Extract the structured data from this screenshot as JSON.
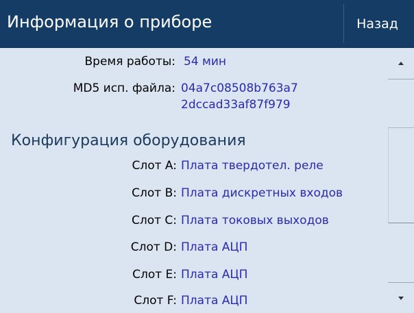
{
  "header": {
    "title": "Информация о приборе",
    "back_label": "Назад"
  },
  "device_info": {
    "uptime_label": "Время работы:",
    "uptime_value": "54 мин",
    "md5_label": "MD5 исп. файла:",
    "md5_line1": "04a7c08508b763a7",
    "md5_line2": "2dccad33af87f979"
  },
  "hardware": {
    "heading": "Конфигурация оборудования",
    "slots": [
      {
        "label": "Слот A:",
        "value": "Плата твердотел. реле"
      },
      {
        "label": "Слот B:",
        "value": "Плата дискретных входов"
      },
      {
        "label": "Слот C:",
        "value": "Плата токовых выходов"
      },
      {
        "label": "Слот D:",
        "value": "Плата АЦП"
      },
      {
        "label": "Слот E:",
        "value": "Плата АЦП"
      },
      {
        "label": "Слот F:",
        "value": "Плата АЦП"
      }
    ]
  },
  "scrollbar": {
    "up_icon": "chevron-up-icon",
    "down_icon": "chevron-down-icon"
  },
  "colors": {
    "header_bg": "#143c64",
    "content_bg": "#dbe5f1",
    "value_text": "#2a2ab0",
    "heading_text": "#1b3a5c"
  }
}
